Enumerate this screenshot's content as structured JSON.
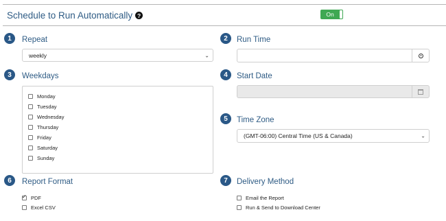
{
  "header": {
    "title": "Schedule to Run Automatically",
    "help_glyph": "?",
    "toggle_label": "On",
    "toggle_color": "#3fa853"
  },
  "sections": {
    "repeat": {
      "number": "1",
      "label": "Repeat",
      "value": "weekly"
    },
    "run_time": {
      "number": "2",
      "label": "Run Time",
      "value": ""
    },
    "weekdays": {
      "number": "3",
      "label": "Weekdays",
      "days": [
        "Monday",
        "Tuesday",
        "Wednesday",
        "Thursday",
        "Friday",
        "Saturday",
        "Sunday"
      ]
    },
    "start_date": {
      "number": "4",
      "label": "Start Date",
      "value": ""
    },
    "time_zone": {
      "number": "5",
      "label": "Time Zone",
      "value": "(GMT-06:00) Central Time (US & Canada)"
    },
    "report_format": {
      "number": "6",
      "label": "Report Format",
      "options": [
        {
          "label": "PDF",
          "checked": true
        },
        {
          "label": "Excel CSV",
          "checked": false
        }
      ]
    },
    "delivery_method": {
      "number": "7",
      "label": "Delivery Method",
      "options": [
        {
          "label": "Email the Report",
          "checked": false
        },
        {
          "label": "Run & Send to Download Center",
          "checked": false
        }
      ]
    }
  },
  "colors": {
    "accent": "#2a5887",
    "heading": "#2e5b84"
  }
}
